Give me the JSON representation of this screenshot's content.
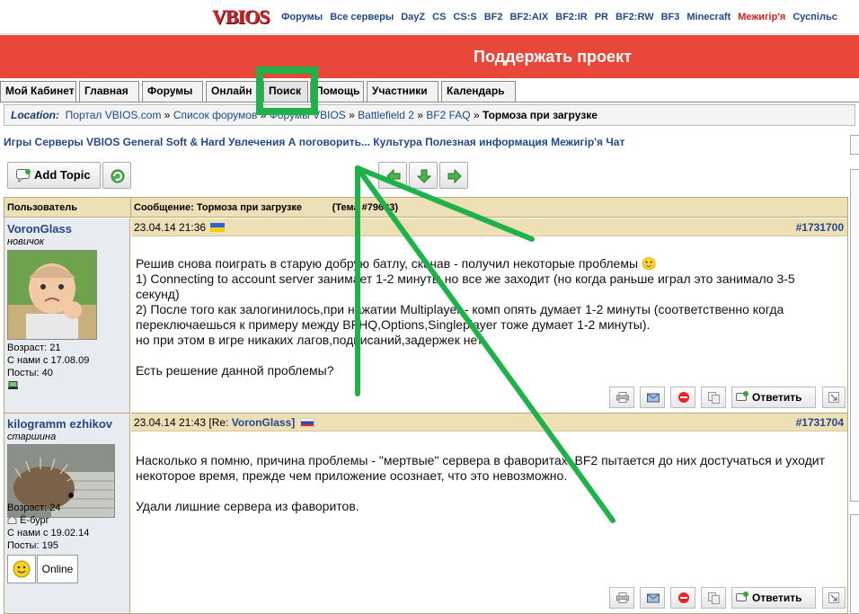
{
  "top_nav": {
    "logo_text": "VBIOS",
    "links": [
      "Форумы",
      "Все серверы",
      "DayZ",
      "CS",
      "CS:S",
      "BF2",
      "BF2:AIX",
      "BF2:IR",
      "PR",
      "BF2:RW",
      "BF3",
      "Minecraft",
      "Межигір'я",
      "Суспільс"
    ]
  },
  "banner": {
    "text": "Поддержать проект",
    "color": "#e9473a"
  },
  "tabs": [
    "Мой Кабинет",
    "Главная",
    "Форумы",
    "Онлайн",
    "Поиск",
    "Помощь",
    "Участники",
    "Календарь"
  ],
  "active_tab": "Поиск",
  "location": {
    "label": "Location:",
    "crumbs": [
      "Портал VBIOS.com",
      "Список форумов",
      "Форумы VBIOS",
      "Battlefield 2",
      "BF2 FAQ"
    ],
    "current": "Тормоза при загрузке",
    "sep": "»"
  },
  "subnav": "Игры Серверы VBIOS General Soft & Hard Увлечения А поговорить... Культура Полезная информация Межигір'я Чат",
  "toolbar": {
    "add_topic": "Add Topic"
  },
  "table": {
    "col_user": "Пользователь",
    "col_message": "Сообщение: Тормоза при загрузке",
    "topic_id": "(Тема #79693)"
  },
  "posts": [
    {
      "user": "VoronGlass",
      "rank": "новичок",
      "age": "Возраст: 21",
      "joined": "С нами с 17.08.09",
      "posts": "Посты: 40",
      "date": "23.04.14 21:36",
      "reply_to": "",
      "number": "#1731700",
      "body": "Решив снова поиграть в старую добрую батлу, скачав - получил некоторые проблемы 🙂\n1) Connecting to account server занимает 1-2 минуты,но все же заходит (но когда раньше играл это занимало 3-5 секунд)\n2) После того как залогинилось,при нажатии Multiplayer - комп опять думает 1-2 минуты (соответственно когда переключаешься к примеру между BFHQ,Options,Singleplayer тоже думает 1-2 минуты).\nно при этом в игре никаких лагов,подвисаний,задержек нет.\n\nЕсть решение данной проблемы?",
      "reply_label": "Ответить"
    },
    {
      "user": "kilogramm ezhikov",
      "rank": "старшина",
      "age": "Возраст: 24",
      "city": "Ё-бург",
      "joined": "С нами с 19.02.14",
      "posts": "Посты: 195",
      "status": "Online",
      "date": "23.04.14 21:43",
      "reply_to_prefix": "[Re:",
      "reply_to": "VoronGlass]",
      "number": "#1731704",
      "body": "Насколько я помню, причина проблемы - \"мертвые\" сервера в фаворитах: BF2 пытается до них достучаться и уходит некоторое время, прежде чем приложение осознает, что это невозможно.\n\nУдали лишние сервера из фаворитов.",
      "reply_label": "Ответить"
    }
  ],
  "colors": {
    "header_bg": "#eddfb6",
    "user_bg": "#e8ecf0",
    "annotation": "#1fb24a",
    "link": "#23488c"
  }
}
